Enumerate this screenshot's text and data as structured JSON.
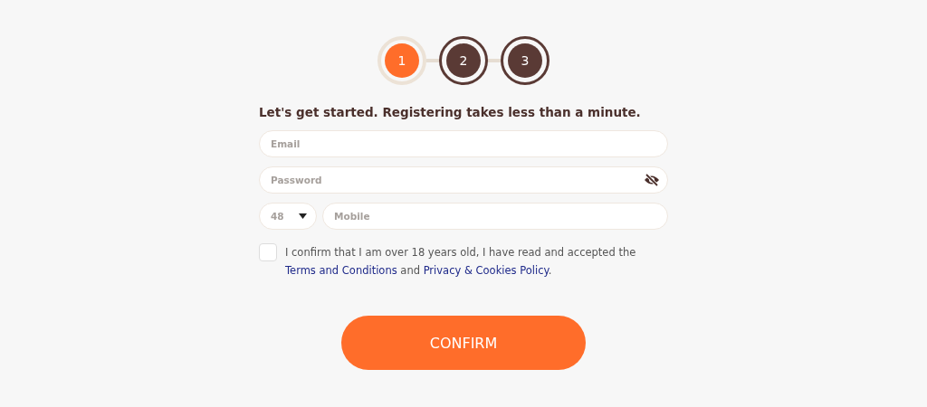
{
  "steps": [
    {
      "label": "1",
      "selected": true
    },
    {
      "label": "2",
      "selected": false
    },
    {
      "label": "3",
      "selected": false
    }
  ],
  "heading": "Let's get started. Registering takes less than a minute.",
  "email": {
    "placeholder": "Email"
  },
  "password": {
    "placeholder": "Password"
  },
  "country_code": {
    "value": "48"
  },
  "mobile": {
    "placeholder": "Mobile"
  },
  "consent": {
    "checked": false,
    "parts": [
      {
        "kind": "text",
        "text": "I confirm that I am over 18 years old, I have read and accepted the "
      },
      {
        "kind": "link",
        "text": "Terms and Conditions"
      },
      {
        "kind": "text",
        "text": " and "
      },
      {
        "kind": "link",
        "text": "Privacy & Cookies Policy"
      },
      {
        "kind": "text",
        "text": "."
      }
    ]
  },
  "confirm_button": "CONFIRM"
}
